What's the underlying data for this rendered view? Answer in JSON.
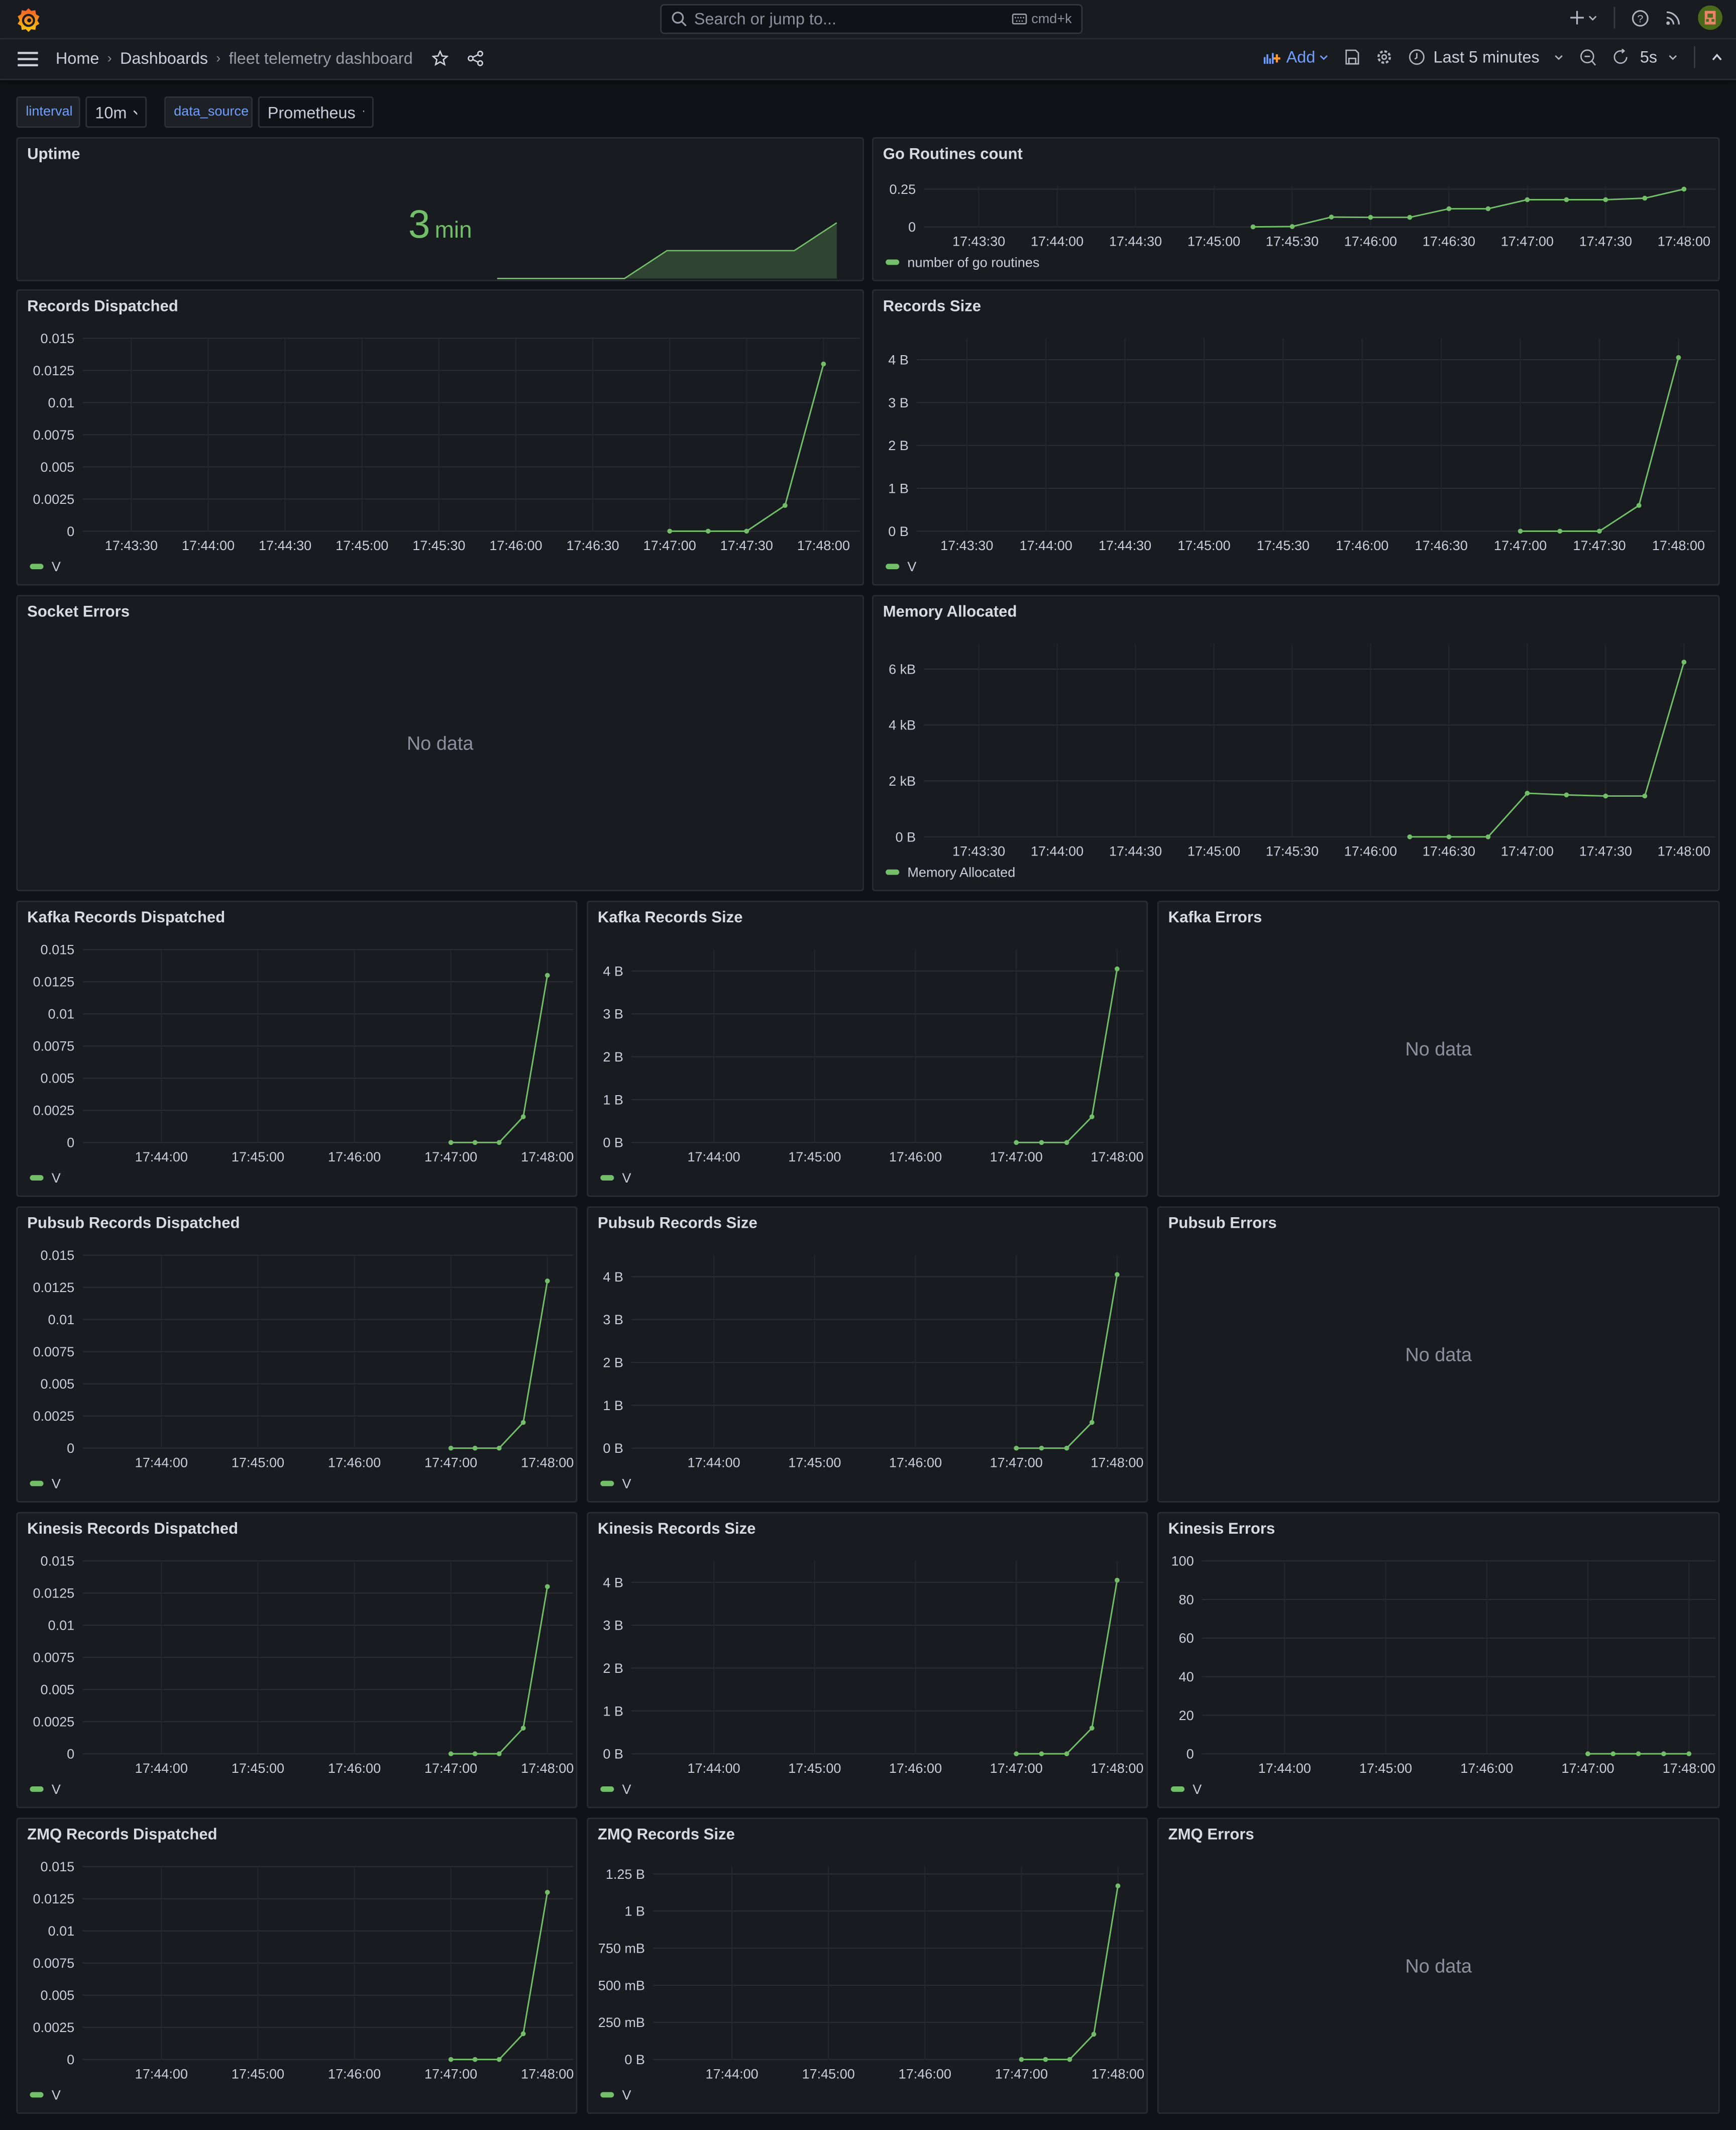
{
  "topbar": {
    "search_placeholder": "Search or jump to...",
    "shortcut": "cmd+k"
  },
  "navbar": {
    "breadcrumbs": [
      "Home",
      "Dashboards",
      "fleet telemetry dashboard"
    ],
    "add_label": "Add",
    "time_range": "Last 5 minutes",
    "refresh_interval": "5s"
  },
  "variables": [
    {
      "label": "linterval",
      "value": "10m"
    },
    {
      "label": "data_source",
      "value": "Prometheus"
    }
  ],
  "colors": {
    "series": "#73bf69",
    "accent": "#6e9fff",
    "background": "#111217",
    "panel": "#181b1f"
  },
  "panels": [
    {
      "title": "Uptime",
      "type": "stat",
      "value": "3",
      "unit": "min",
      "sparkline": [
        0,
        0,
        0,
        0,
        60,
        60,
        60,
        60,
        120
      ]
    },
    {
      "title": "Go Routines count",
      "type": "timeseries",
      "legend": "number of go routines",
      "x_ticks": [
        "17:43:30",
        "17:44:00",
        "17:44:30",
        "17:45:00",
        "17:45:30",
        "17:46:00",
        "17:46:30",
        "17:47:00",
        "17:47:30",
        "17:48:00"
      ],
      "y_ticks": [
        {
          "v": 0,
          "label": "0"
        },
        {
          "v": 0.25,
          "label": "0.25"
        }
      ],
      "ylim": [
        0,
        0.27
      ],
      "xlim": [
        "17:43:09",
        "17:48:09"
      ],
      "x": [
        "17:45:15",
        "17:45:30",
        "17:45:45",
        "17:46:00",
        "17:46:15",
        "17:46:30",
        "17:46:45",
        "17:47:00",
        "17:47:15",
        "17:47:30",
        "17:47:45",
        "17:48:00"
      ],
      "y": [
        0,
        0.002,
        0.065,
        0.063,
        0.063,
        0.12,
        0.12,
        0.18,
        0.18,
        0.18,
        0.19,
        0.25
      ]
    },
    {
      "title": "Records Dispatched",
      "type": "timeseries",
      "legend": "V",
      "x_ticks": [
        "17:43:30",
        "17:44:00",
        "17:44:30",
        "17:45:00",
        "17:45:30",
        "17:46:00",
        "17:46:30",
        "17:47:00",
        "17:47:30",
        "17:48:00"
      ],
      "y_ticks": [
        {
          "v": 0,
          "label": "0"
        },
        {
          "v": 0.0025,
          "label": "0.0025"
        },
        {
          "v": 0.005,
          "label": "0.005"
        },
        {
          "v": 0.0075,
          "label": "0.0075"
        },
        {
          "v": 0.01,
          "label": "0.01"
        },
        {
          "v": 0.0125,
          "label": "0.0125"
        },
        {
          "v": 0.015,
          "label": "0.015"
        }
      ],
      "ylim": [
        0,
        0.015
      ],
      "xlim": [
        "17:43:11",
        "17:48:11"
      ],
      "x": [
        "17:47:00",
        "17:47:15",
        "17:47:30",
        "17:47:45",
        "17:48:00"
      ],
      "y": [
        0,
        0,
        0,
        0.002,
        0.013
      ]
    },
    {
      "title": "Records Size",
      "type": "timeseries",
      "legend": "V",
      "x_ticks": [
        "17:43:30",
        "17:44:00",
        "17:44:30",
        "17:45:00",
        "17:45:30",
        "17:46:00",
        "17:46:30",
        "17:47:00",
        "17:47:30",
        "17:48:00"
      ],
      "y_ticks": [
        {
          "v": 0,
          "label": "0 B"
        },
        {
          "v": 1,
          "label": "1 B"
        },
        {
          "v": 2,
          "label": "2 B"
        },
        {
          "v": 3,
          "label": "3 B"
        },
        {
          "v": 4,
          "label": "4 B"
        }
      ],
      "ylim": [
        0,
        4.5
      ],
      "xlim": [
        "17:43:11",
        "17:48:11"
      ],
      "x": [
        "17:47:00",
        "17:47:15",
        "17:47:30",
        "17:47:45",
        "17:48:00"
      ],
      "y": [
        0,
        0,
        0,
        0.6,
        4.05
      ]
    },
    {
      "title": "Socket Errors",
      "type": "nodata",
      "message": "No data"
    },
    {
      "title": "Memory Allocated",
      "type": "timeseries",
      "legend": "Memory Allocated",
      "x_ticks": [
        "17:43:30",
        "17:44:00",
        "17:44:30",
        "17:45:00",
        "17:45:30",
        "17:46:00",
        "17:46:30",
        "17:47:00",
        "17:47:30",
        "17:48:00"
      ],
      "y_ticks": [
        {
          "v": 0,
          "label": "0 B"
        },
        {
          "v": 2000,
          "label": "2 kB"
        },
        {
          "v": 4000,
          "label": "4 kB"
        },
        {
          "v": 6000,
          "label": "6 kB"
        }
      ],
      "ylim": [
        0,
        6900
      ],
      "xlim": [
        "17:43:09",
        "17:48:09"
      ],
      "x": [
        "17:46:15",
        "17:46:30",
        "17:46:45",
        "17:47:00",
        "17:47:15",
        "17:47:30",
        "17:47:45",
        "17:48:00"
      ],
      "y": [
        0,
        0,
        0,
        1560,
        1500,
        1460,
        1460,
        6250
      ]
    },
    {
      "title": "Kafka Records Dispatched",
      "type": "timeseries",
      "legend": "V",
      "x_ticks": [
        "17:44:00",
        "17:45:00",
        "17:46:00",
        "17:47:00",
        "17:48:00"
      ],
      "y_ticks": [
        {
          "v": 0,
          "label": "0"
        },
        {
          "v": 0.0025,
          "label": "0.0025"
        },
        {
          "v": 0.005,
          "label": "0.005"
        },
        {
          "v": 0.0075,
          "label": "0.0075"
        },
        {
          "v": 0.01,
          "label": "0.01"
        },
        {
          "v": 0.0125,
          "label": "0.0125"
        },
        {
          "v": 0.015,
          "label": "0.015"
        }
      ],
      "ylim": [
        0,
        0.015
      ],
      "xlim": [
        "17:43:11",
        "17:48:11"
      ],
      "x": [
        "17:47:00",
        "17:47:15",
        "17:47:30",
        "17:47:45",
        "17:48:00"
      ],
      "y": [
        0,
        0,
        0,
        0.002,
        0.013
      ]
    },
    {
      "title": "Kafka Records Size",
      "type": "timeseries",
      "legend": "V",
      "x_ticks": [
        "17:44:00",
        "17:45:00",
        "17:46:00",
        "17:47:00",
        "17:48:00"
      ],
      "y_ticks": [
        {
          "v": 0,
          "label": "0 B"
        },
        {
          "v": 1,
          "label": "1 B"
        },
        {
          "v": 2,
          "label": "2 B"
        },
        {
          "v": 3,
          "label": "3 B"
        },
        {
          "v": 4,
          "label": "4 B"
        }
      ],
      "ylim": [
        0,
        4.5
      ],
      "xlim": [
        "17:43:11",
        "17:48:11"
      ],
      "x": [
        "17:47:00",
        "17:47:15",
        "17:47:30",
        "17:47:45",
        "17:48:00"
      ],
      "y": [
        0,
        0,
        0,
        0.6,
        4.05
      ]
    },
    {
      "title": "Kafka Errors",
      "type": "nodata",
      "message": "No data"
    },
    {
      "title": "Pubsub Records Dispatched",
      "type": "timeseries",
      "legend": "V",
      "x_ticks": [
        "17:44:00",
        "17:45:00",
        "17:46:00",
        "17:47:00",
        "17:48:00"
      ],
      "y_ticks": [
        {
          "v": 0,
          "label": "0"
        },
        {
          "v": 0.0025,
          "label": "0.0025"
        },
        {
          "v": 0.005,
          "label": "0.005"
        },
        {
          "v": 0.0075,
          "label": "0.0075"
        },
        {
          "v": 0.01,
          "label": "0.01"
        },
        {
          "v": 0.0125,
          "label": "0.0125"
        },
        {
          "v": 0.015,
          "label": "0.015"
        }
      ],
      "ylim": [
        0,
        0.015
      ],
      "xlim": [
        "17:43:11",
        "17:48:11"
      ],
      "x": [
        "17:47:00",
        "17:47:15",
        "17:47:30",
        "17:47:45",
        "17:48:00"
      ],
      "y": [
        0,
        0,
        0,
        0.002,
        0.013
      ]
    },
    {
      "title": "Pubsub Records Size",
      "type": "timeseries",
      "legend": "V",
      "x_ticks": [
        "17:44:00",
        "17:45:00",
        "17:46:00",
        "17:47:00",
        "17:48:00"
      ],
      "y_ticks": [
        {
          "v": 0,
          "label": "0 B"
        },
        {
          "v": 1,
          "label": "1 B"
        },
        {
          "v": 2,
          "label": "2 B"
        },
        {
          "v": 3,
          "label": "3 B"
        },
        {
          "v": 4,
          "label": "4 B"
        }
      ],
      "ylim": [
        0,
        4.5
      ],
      "xlim": [
        "17:43:11",
        "17:48:11"
      ],
      "x": [
        "17:47:00",
        "17:47:15",
        "17:47:30",
        "17:47:45",
        "17:48:00"
      ],
      "y": [
        0,
        0,
        0,
        0.6,
        4.05
      ]
    },
    {
      "title": "Pubsub Errors",
      "type": "nodata",
      "message": "No data"
    },
    {
      "title": "Kinesis Records Dispatched",
      "type": "timeseries",
      "legend": "V",
      "x_ticks": [
        "17:44:00",
        "17:45:00",
        "17:46:00",
        "17:47:00",
        "17:48:00"
      ],
      "y_ticks": [
        {
          "v": 0,
          "label": "0"
        },
        {
          "v": 0.0025,
          "label": "0.0025"
        },
        {
          "v": 0.005,
          "label": "0.005"
        },
        {
          "v": 0.0075,
          "label": "0.0075"
        },
        {
          "v": 0.01,
          "label": "0.01"
        },
        {
          "v": 0.0125,
          "label": "0.0125"
        },
        {
          "v": 0.015,
          "label": "0.015"
        }
      ],
      "ylim": [
        0,
        0.015
      ],
      "xlim": [
        "17:43:11",
        "17:48:11"
      ],
      "x": [
        "17:47:00",
        "17:47:15",
        "17:47:30",
        "17:47:45",
        "17:48:00"
      ],
      "y": [
        0,
        0,
        0,
        0.002,
        0.013
      ]
    },
    {
      "title": "Kinesis Records Size",
      "type": "timeseries",
      "legend": "V",
      "x_ticks": [
        "17:44:00",
        "17:45:00",
        "17:46:00",
        "17:47:00",
        "17:48:00"
      ],
      "y_ticks": [
        {
          "v": 0,
          "label": "0 B"
        },
        {
          "v": 1,
          "label": "1 B"
        },
        {
          "v": 2,
          "label": "2 B"
        },
        {
          "v": 3,
          "label": "3 B"
        },
        {
          "v": 4,
          "label": "4 B"
        }
      ],
      "ylim": [
        0,
        4.5
      ],
      "xlim": [
        "17:43:11",
        "17:48:11"
      ],
      "x": [
        "17:47:00",
        "17:47:15",
        "17:47:30",
        "17:47:45",
        "17:48:00"
      ],
      "y": [
        0,
        0,
        0,
        0.6,
        4.05
      ]
    },
    {
      "title": "Kinesis Errors",
      "type": "timeseries",
      "legend": "V",
      "x_ticks": [
        "17:44:00",
        "17:45:00",
        "17:46:00",
        "17:47:00",
        "17:48:00"
      ],
      "y_ticks": [
        {
          "v": 0,
          "label": "0"
        },
        {
          "v": 20,
          "label": "20"
        },
        {
          "v": 40,
          "label": "40"
        },
        {
          "v": 60,
          "label": "60"
        },
        {
          "v": 80,
          "label": "80"
        },
        {
          "v": 100,
          "label": "100"
        }
      ],
      "ylim": [
        0,
        100
      ],
      "xlim": [
        "17:43:11",
        "17:48:11"
      ],
      "x": [
        "17:47:00",
        "17:47:15",
        "17:47:30",
        "17:47:45",
        "17:48:00"
      ],
      "y": [
        0,
        0,
        0,
        0,
        0
      ]
    },
    {
      "title": "ZMQ Records Dispatched",
      "type": "timeseries",
      "legend": "V",
      "x_ticks": [
        "17:44:00",
        "17:45:00",
        "17:46:00",
        "17:47:00",
        "17:48:00"
      ],
      "y_ticks": [
        {
          "v": 0,
          "label": "0"
        },
        {
          "v": 0.0025,
          "label": "0.0025"
        },
        {
          "v": 0.005,
          "label": "0.005"
        },
        {
          "v": 0.0075,
          "label": "0.0075"
        },
        {
          "v": 0.01,
          "label": "0.01"
        },
        {
          "v": 0.0125,
          "label": "0.0125"
        },
        {
          "v": 0.015,
          "label": "0.015"
        }
      ],
      "ylim": [
        0,
        0.015
      ],
      "xlim": [
        "17:43:11",
        "17:48:11"
      ],
      "x": [
        "17:47:00",
        "17:47:15",
        "17:47:30",
        "17:47:45",
        "17:48:00"
      ],
      "y": [
        0,
        0,
        0,
        0.002,
        0.013
      ]
    },
    {
      "title": "ZMQ Records Size",
      "type": "timeseries",
      "legend": "V",
      "x_ticks": [
        "17:44:00",
        "17:45:00",
        "17:46:00",
        "17:47:00",
        "17:48:00"
      ],
      "y_ticks": [
        {
          "v": 0,
          "label": "0 B"
        },
        {
          "v": 0.25,
          "label": "250 mB"
        },
        {
          "v": 0.5,
          "label": "500 mB"
        },
        {
          "v": 0.75,
          "label": "750 mB"
        },
        {
          "v": 1,
          "label": "1 B"
        },
        {
          "v": 1.25,
          "label": "1.25 B"
        }
      ],
      "ylim": [
        0,
        1.3
      ],
      "xlim": [
        "17:43:11",
        "17:48:11"
      ],
      "x": [
        "17:47:00",
        "17:47:15",
        "17:47:30",
        "17:47:45",
        "17:48:00"
      ],
      "y": [
        0,
        0,
        0,
        0.17,
        1.17
      ]
    },
    {
      "title": "ZMQ Errors",
      "type": "nodata",
      "message": "No data"
    }
  ]
}
